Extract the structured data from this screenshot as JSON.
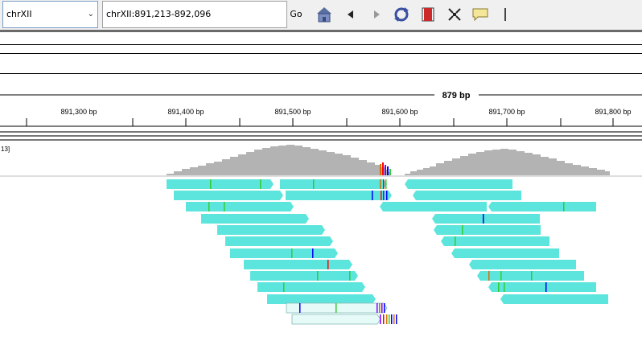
{
  "toolbar": {
    "chromosome": "chrXII",
    "locus": "chrXII:891,213-892,096",
    "go_label": "Go"
  },
  "ruler": {
    "span_label": "879 bp",
    "ticks": [
      "891,300 bp",
      "891,400 bp",
      "891,500 bp",
      "891,600 bp",
      "891,700 bp",
      "891,800 bp"
    ]
  },
  "coverage": {
    "scale_label": "13]"
  },
  "colors": {
    "read": "#5ce5dc",
    "read_faint": "#e6faf8",
    "coverage": "#b3b3b3",
    "mismatch_A": "#33cc33",
    "mismatch_C": "#0000ff",
    "mismatch_G": "#d17105",
    "mismatch_T": "#ff0000",
    "insertion": "#8000ff"
  }
}
